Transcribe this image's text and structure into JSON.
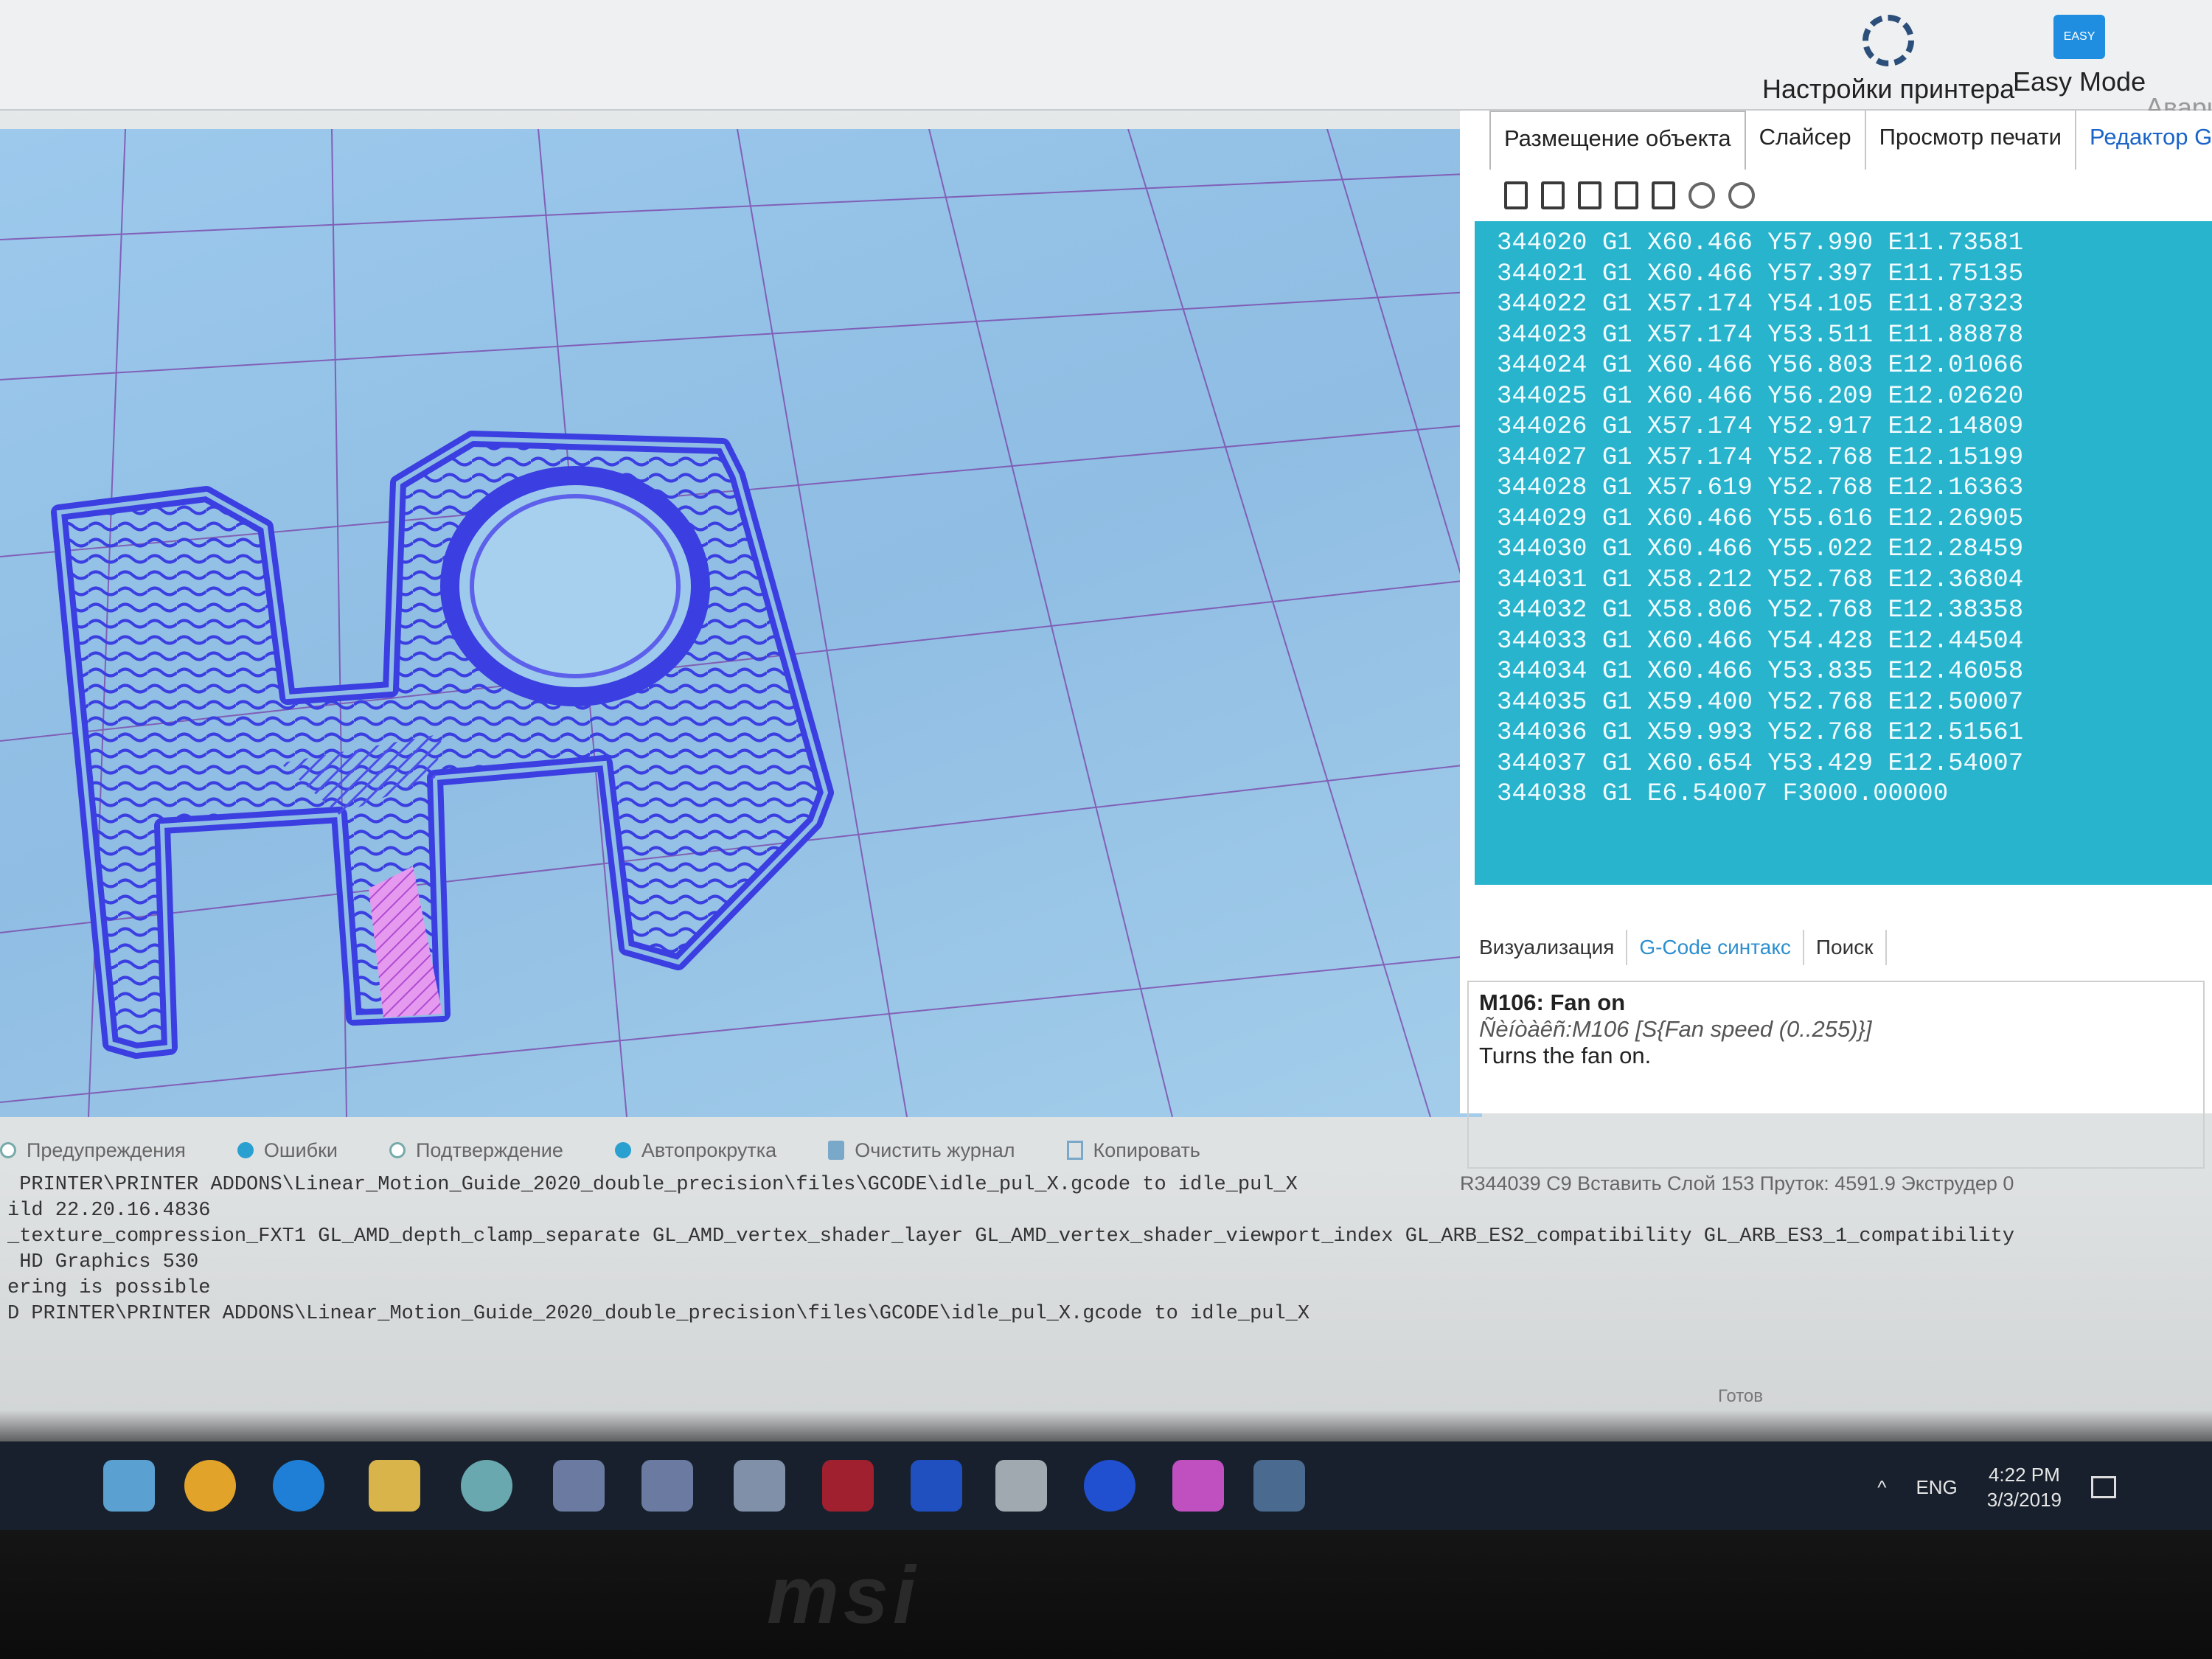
{
  "toolbar": {
    "printer_settings": "Настройки принтера",
    "easy_mode": "Easy Mode",
    "emergency": "Авари"
  },
  "tabs": [
    "Размещение объекта",
    "Слайсер",
    "Просмотр печати",
    "Редактор G-Код"
  ],
  "gcode_lines": [
    "344020 G1 X60.466 Y57.990 E11.73581",
    "344021 G1 X60.466 Y57.397 E11.75135",
    "344022 G1 X57.174 Y54.105 E11.87323",
    "344023 G1 X57.174 Y53.511 E11.88878",
    "344024 G1 X60.466 Y56.803 E12.01066",
    "344025 G1 X60.466 Y56.209 E12.02620",
    "344026 G1 X57.174 Y52.917 E12.14809",
    "344027 G1 X57.174 Y52.768 E12.15199",
    "344028 G1 X57.619 Y52.768 E12.16363",
    "344029 G1 X60.466 Y55.616 E12.26905",
    "344030 G1 X60.466 Y55.022 E12.28459",
    "344031 G1 X58.212 Y52.768 E12.36804",
    "344032 G1 X58.806 Y52.768 E12.38358",
    "344033 G1 X60.466 Y54.428 E12.44504",
    "344034 G1 X60.466 Y53.835 E12.46058",
    "344035 G1 X59.400 Y52.768 E12.50007",
    "344036 G1 X59.993 Y52.768 E12.51561",
    "344037 G1 X60.654 Y53.429 E12.54007",
    "344038 G1 E6.54007 F3000.00000"
  ],
  "subtabs": [
    "Визуализация",
    "G-Code синтакс",
    "Поиск"
  ],
  "help": {
    "title": "M106: Fan on",
    "syntax": "Ñèíòàêñ:M106 [S{Fan speed (0..255)}]",
    "desc": "Turns the fan on."
  },
  "status_line": "R344039  C9  Вставить  Слой 153 Пруток: 4591.9  Экструдер 0",
  "log_options": {
    "warnings": "Предупреждения",
    "errors": "Ошибки",
    "confirm": "Подтверждение",
    "autoscroll": "Автопрокрутка",
    "clear_log": "Очистить журнал",
    "copy": "Копировать"
  },
  "log_lines": [
    " PRINTER\\PRINTER ADDONS\\Linear_Motion_Guide_2020_double_precision\\files\\GCODE\\idle_pul_X.gcode to idle_pul_X",
    "ild 22.20.16.4836",
    "_texture_compression_FXT1 GL_AMD_depth_clamp_separate GL_AMD_vertex_shader_layer GL_AMD_vertex_shader_viewport_index GL_ARB_ES2_compatibility GL_ARB_ES3_1_compatibility",
    " HD Graphics 530",
    "ering is possible",
    "D PRINTER\\PRINTER ADDONS\\Linear_Motion_Guide_2020_double_precision\\files\\GCODE\\idle_pul_X.gcode to idle_pul_X"
  ],
  "ready": "Готов",
  "tray": {
    "lang": "ENG",
    "time": "4:22 PM",
    "date": "3/3/2019"
  },
  "brand": "msi",
  "colors": {
    "gcode_bg": "#27b4cc",
    "viewport_bg": "#9cc9ec",
    "toolpath": "#3b3ee0",
    "infill_highlight": "#d47ae6",
    "grid": "#7a3fa8"
  }
}
